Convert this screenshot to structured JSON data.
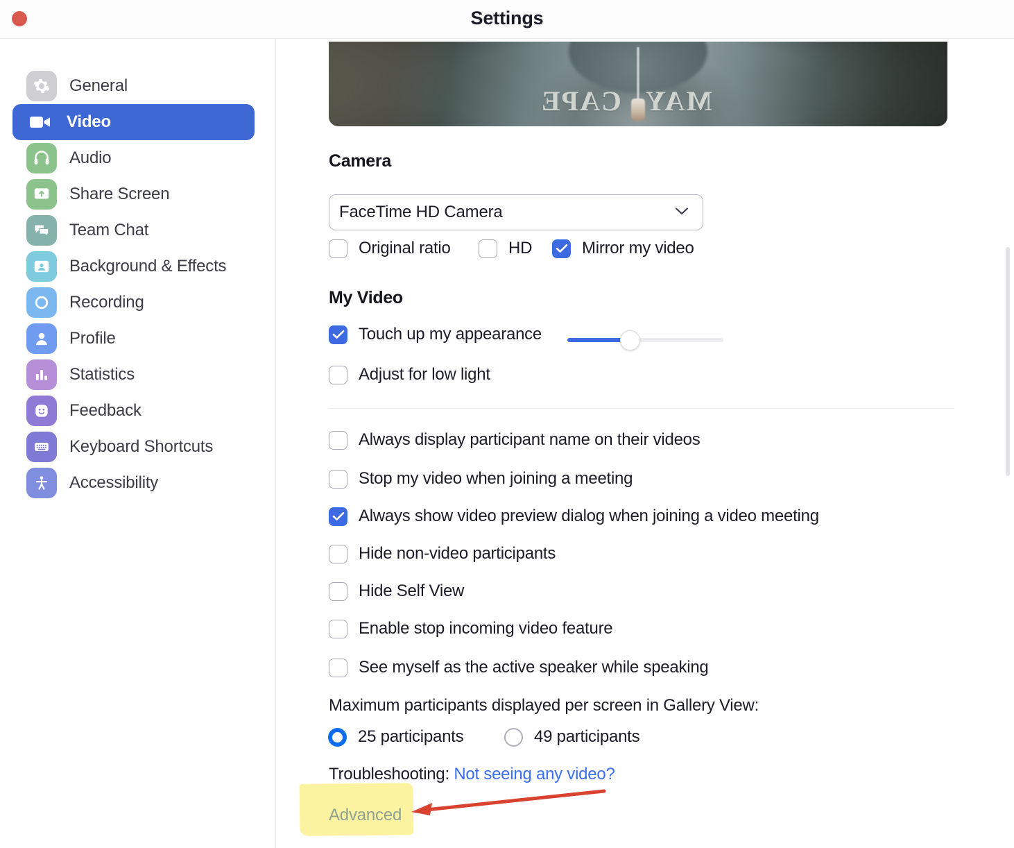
{
  "window": {
    "title": "Settings",
    "close_button": "close-dot",
    "accent_color": "#3e68d4",
    "close_color": "#d9594f"
  },
  "sidebar": {
    "items": [
      {
        "label": "General",
        "icon": "gear-icon",
        "icon_color": "#cfcfd3",
        "active": false
      },
      {
        "label": "Video",
        "icon": "video-camera-icon",
        "icon_color": "#3e68d4",
        "active": true
      },
      {
        "label": "Audio",
        "icon": "headphones-icon",
        "icon_color": "#8cc28c",
        "active": false
      },
      {
        "label": "Share Screen",
        "icon": "share-screen-icon",
        "icon_color": "#8cc28c",
        "active": false
      },
      {
        "label": "Team Chat",
        "icon": "chat-bubbles-icon",
        "icon_color": "#85b3ab",
        "active": false
      },
      {
        "label": "Background & Effects",
        "icon": "person-frame-icon",
        "icon_color": "#7ecbdd",
        "active": false
      },
      {
        "label": "Recording",
        "icon": "record-circle-icon",
        "icon_color": "#7ab8ef",
        "active": false
      },
      {
        "label": "Profile",
        "icon": "person-icon",
        "icon_color": "#6f9bf0",
        "active": false
      },
      {
        "label": "Statistics",
        "icon": "bar-chart-icon",
        "icon_color": "#b78ed8",
        "active": false
      },
      {
        "label": "Feedback",
        "icon": "smiley-icon",
        "icon_color": "#8f7ad6",
        "active": false
      },
      {
        "label": "Keyboard Shortcuts",
        "icon": "keyboard-icon",
        "icon_color": "#7e7ad6",
        "active": false
      },
      {
        "label": "Accessibility",
        "icon": "accessibility-icon",
        "icon_color": "#7f8ede",
        "active": false
      }
    ]
  },
  "main": {
    "preview": {
      "shirt_text_left": "CAPE",
      "shirt_text_right": "MAY"
    },
    "camera": {
      "heading": "Camera",
      "selected": "FaceTime HD Camera",
      "options": [
        "FaceTime HD Camera"
      ],
      "checkboxes": [
        {
          "label": "Original ratio",
          "checked": false
        },
        {
          "label": "HD",
          "checked": false
        },
        {
          "label": "Mirror my video",
          "checked": true
        }
      ]
    },
    "my_video": {
      "heading": "My Video",
      "touch_up": {
        "label": "Touch up my appearance",
        "checked": true,
        "slider_percent": 40
      },
      "low_light": {
        "label": "Adjust for low light",
        "checked": false
      }
    },
    "options": [
      {
        "label": "Always display participant name on their videos",
        "checked": false
      },
      {
        "label": "Stop my video when joining a meeting",
        "checked": false
      },
      {
        "label": "Always show video preview dialog when joining a video meeting",
        "checked": true
      },
      {
        "label": "Hide non-video participants",
        "checked": false
      },
      {
        "label": "Hide Self View",
        "checked": false
      },
      {
        "label": "Enable stop incoming video feature",
        "checked": false
      },
      {
        "label": "See myself as the active speaker while speaking",
        "checked": false
      }
    ],
    "gallery": {
      "label": "Maximum participants displayed per screen in Gallery View:",
      "radios": [
        {
          "label": "25 participants",
          "selected": true
        },
        {
          "label": "49 participants",
          "selected": false
        }
      ]
    },
    "troubleshooting": {
      "prefix": "Troubleshooting:",
      "link": "Not seeing any video?"
    },
    "advanced": {
      "label": "Advanced",
      "highlight_color": "#fbf3a0",
      "text_color": "#8fa093"
    },
    "annotation": {
      "arrow_color": "#d9422e"
    }
  }
}
